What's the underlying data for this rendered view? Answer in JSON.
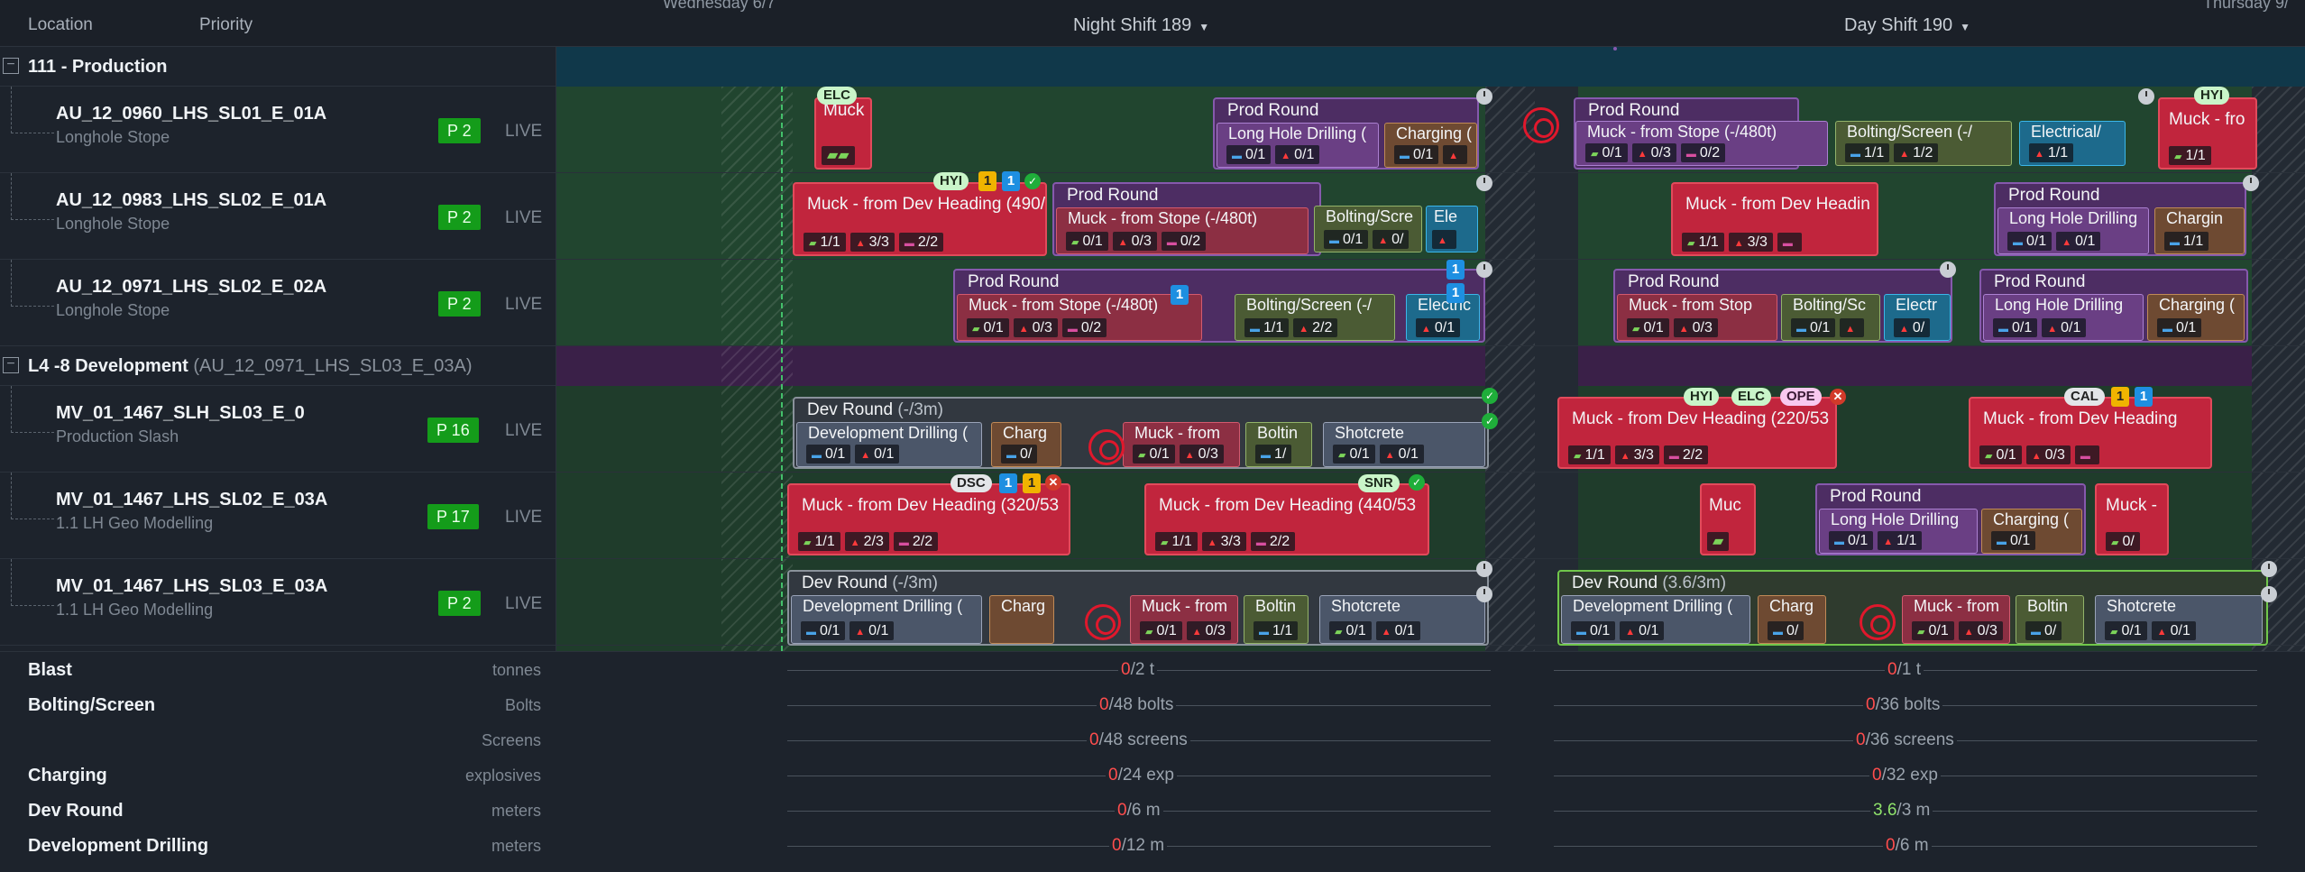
{
  "header": {
    "col_location": "Location",
    "col_priority": "Priority",
    "day_left": "Wednesday 6/7",
    "day_right": "Thursday 9/",
    "shift_left": "Night Shift 189",
    "shift_right": "Day Shift 190",
    "caret": "▼"
  },
  "groups": [
    {
      "name": "111 - Production",
      "sub": "",
      "toggle": "−"
    },
    {
      "name": "L4 -8 Development",
      "sub": "(AU_12_0971_LHS_SL03_E_03A)",
      "toggle": "−"
    }
  ],
  "rows": [
    {
      "name": "AU_12_0960_LHS_SL01_E_01A",
      "sub": "Longhole Stope",
      "priority": "P 2",
      "status": "LIVE"
    },
    {
      "name": "AU_12_0983_LHS_SL02_E_01A",
      "sub": "Longhole Stope",
      "priority": "P 2",
      "status": "LIVE"
    },
    {
      "name": "AU_12_0971_LHS_SL02_E_02A",
      "sub": "Longhole Stope",
      "priority": "P 2",
      "status": "LIVE"
    },
    {
      "name": "MV_01_1467_SLH_SL03_E_0",
      "sub": "Production Slash",
      "priority": "P 16",
      "status": "LIVE"
    },
    {
      "name": "MV_01_1467_LHS_SL02_E_03A",
      "sub": "1.1 LH Geo Modelling",
      "priority": "P 17",
      "status": "LIVE"
    },
    {
      "name": "MV_01_1467_LHS_SL03_E_03A",
      "sub": "1.1 LH Geo Modelling",
      "priority": "P 2",
      "status": "LIVE"
    }
  ],
  "tasks": {
    "r1": {
      "muck": "Muck",
      "tag_elc": "ELC",
      "prod1": "Prod Round",
      "lhd1": "Long Hole Drilling (",
      "lhd1_m1": "0/1",
      "lhd1_m2": "0/1",
      "charging1": "Charging (",
      "charging1_m1": "0/1",
      "prod2": "Prod Round",
      "muck2": "Muck - from Stope (-/480t)",
      "muck2_m1": "0/1",
      "muck2_m2": "0/3",
      "muck2_m3": "0/2",
      "bolt2": "Bolting/Screen (-/",
      "bolt2_m1": "1/1",
      "bolt2_m2": "1/2",
      "elec2": "Electrical/",
      "elec2_m1": "1/1",
      "muck3": "Muck - fro",
      "muck3_m1": "1/1",
      "tag_hyi": "HYI"
    },
    "r2": {
      "muck1": "Muck - from Dev Heading (490/",
      "muck1_m1": "1/1",
      "muck1_m2": "3/3",
      "muck1_m3": "2/2",
      "tag_hyi": "HYI",
      "cnt_y": "1",
      "cnt_b": "1",
      "prod1": "Prod Round",
      "muckst": "Muck - from Stope (-/480t)",
      "muckst_m1": "0/1",
      "muckst_m2": "0/3",
      "muckst_m3": "0/2",
      "bolt": "Bolting/Scre",
      "bolt_m1": "0/1",
      "bolt_m2": "0/",
      "ele": "Ele",
      "muck2": "Muck - from Dev Headin",
      "muck2_m1": "1/1",
      "muck2_m2": "3/3",
      "prod2": "Prod Round",
      "lhd2": "Long Hole Drilling",
      "lhd2_m1": "0/1",
      "lhd2_m2": "0/1",
      "charg2": "Chargin",
      "charg2_m1": "1/1"
    },
    "r3": {
      "prod1": "Prod Round",
      "muckst": "Muck - from Stope (-/480t)",
      "muckst_m1": "0/1",
      "muckst_m2": "0/3",
      "muckst_m3": "0/2",
      "cnt1": "1",
      "bolt": "Bolting/Screen (-/",
      "bolt_m1": "1/1",
      "bolt_m2": "2/2",
      "cnt2": "1",
      "cnt3": "1",
      "elec": "Electric",
      "elec_m1": "0/1",
      "prod2": "Prod Round",
      "muck2": "Muck - from Stop",
      "muck2_m1": "0/1",
      "muck2_m2": "0/3",
      "bolt2": "Bolting/Sc",
      "bolt2_m1": "0/1",
      "elec2": "Electr",
      "elec2_m1": "0/",
      "prod3": "Prod Round",
      "lhd3": "Long Hole Drilling",
      "lhd3_m1": "0/1",
      "lhd3_m2": "0/1",
      "charg3": "Charging (",
      "charg3_m1": "0/1"
    },
    "r4": {
      "dev": "Dev Round",
      "dev_sub": "(-/3m)",
      "dd": "Development Drilling (",
      "dd_m1": "0/1",
      "dd_m2": "0/1",
      "charg": "Charg",
      "charg_m1": "0/",
      "muck": "Muck - from",
      "muck_m1": "0/1",
      "muck_m2": "0/3",
      "bolt": "Boltin",
      "bolt_m1": "1/",
      "shot": "Shotcrete",
      "shot_m1": "0/1",
      "shot_m2": "0/1",
      "muck2": "Muck - from Dev Heading (220/53",
      "muck2_m1": "1/1",
      "muck2_m2": "3/3",
      "muck2_m3": "2/2",
      "tag_hyi": "HYI",
      "tag_elc": "ELC",
      "tag_ope": "OPE",
      "muck3": "Muck - from Dev Heading",
      "muck3_m1": "0/1",
      "muck3_m2": "0/3",
      "tag_cal": "CAL",
      "cnt_y": "1",
      "cnt_b": "1"
    },
    "r5": {
      "muck1": "Muck - from Dev Heading (320/53",
      "muck1_m1": "1/1",
      "muck1_m2": "2/3",
      "muck1_m3": "2/2",
      "tag_dsc": "DSC",
      "cnt_b": "1",
      "cnt_y": "1",
      "muck2": "Muck - from Dev Heading (440/53",
      "muck2_m1": "1/1",
      "muck2_m2": "3/3",
      "muck2_m3": "2/2",
      "tag_snr": "SNR",
      "muc": "Muc",
      "prod": "Prod Round",
      "lhd": "Long Hole Drilling",
      "lhd_m1": "0/1",
      "lhd_m2": "1/1",
      "charg": "Charging (",
      "charg_m1": "0/1",
      "muck3": "Muck -",
      "muck3_m1": "0/"
    },
    "r6": {
      "dev": "Dev Round",
      "dev_sub": "(-/3m)",
      "dd": "Development Drilling (",
      "dd_m1": "0/1",
      "dd_m2": "0/1",
      "charg": "Charg",
      "muck": "Muck - from",
      "muck_m1": "0/1",
      "muck_m2": "0/3",
      "bolt": "Boltin",
      "bolt_m1": "1/1",
      "shot": "Shotcrete",
      "shot_m1": "0/1",
      "shot_m2": "0/1",
      "dev2": "Dev Round",
      "dev2_sub": "(3.6/3m)",
      "dd2": "Development Drilling (",
      "dd2_m1": "0/1",
      "dd2_m2": "0/1",
      "charg2": "Charg",
      "charg2_m1": "0/",
      "muck2": "Muck - from",
      "muck2_m1": "0/1",
      "muck2_m2": "0/3",
      "bolt2": "Boltin",
      "bolt2_m1": "0/",
      "shot2": "Shotcrete",
      "shot2_m1": "0/1",
      "shot2_m2": "0/1"
    }
  },
  "summary": [
    {
      "label": "Blast",
      "unit": "tonnes",
      "left_v": "0",
      "left_rest": "/2 t",
      "right_v": "0",
      "right_rest": "/1 t"
    },
    {
      "label": "Bolting/Screen",
      "unit": "Bolts",
      "left_v": "0",
      "left_rest": "/48 bolts",
      "right_v": "0",
      "right_rest": "/36 bolts"
    },
    {
      "label": "",
      "unit": "Screens",
      "left_v": "0",
      "left_rest": "/48 screens",
      "right_v": "0",
      "right_rest": "/36 screens"
    },
    {
      "label": "Charging",
      "unit": "explosives",
      "left_v": "0",
      "left_rest": "/24 exp",
      "right_v": "0",
      "right_rest": "/32 exp"
    },
    {
      "label": "Dev Round",
      "unit": "meters",
      "left_v": "0",
      "left_rest": "/6 m",
      "right_v": "3.6",
      "right_rest": "/3 m"
    },
    {
      "label": "Development Drilling",
      "unit": "meters",
      "left_v": "0",
      "left_rest": "/12 m",
      "right_v": "0",
      "right_rest": "/6 m"
    }
  ],
  "colors": {
    "production_band": "#10384a",
    "development_band": "#3a2048",
    "priority": "#149c1a",
    "accent_green": "#43c06a"
  }
}
